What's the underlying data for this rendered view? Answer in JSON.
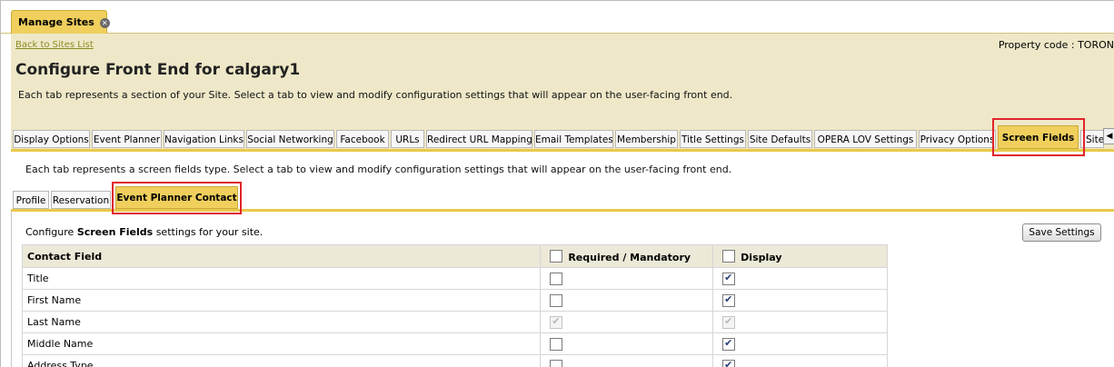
{
  "top_tab": {
    "label": "Manage Sites",
    "close_glyph": "✕"
  },
  "header": {
    "back_link": "Back to Sites List",
    "property_code": "Property code : TORON",
    "title": "Configure Front End for calgary1",
    "description": "Each tab represents a section of your Site. Select a tab to view and modify configuration settings that will appear on the user-facing front end."
  },
  "tabs": [
    {
      "label": "Display Options"
    },
    {
      "label": "Event Planner"
    },
    {
      "label": "Navigation Links"
    },
    {
      "label": "Social Networking"
    },
    {
      "label": "Facebook"
    },
    {
      "label": "URLs"
    },
    {
      "label": "Redirect URL Mapping"
    },
    {
      "label": "Email Templates"
    },
    {
      "label": "Membership"
    },
    {
      "label": "Title Settings"
    },
    {
      "label": "Site Defaults"
    },
    {
      "label": "OPERA LOV Settings"
    },
    {
      "label": "Privacy Options"
    },
    {
      "label": "Screen Fields",
      "active": true
    },
    {
      "label": "Site"
    }
  ],
  "scroll_left_glyph": "◀",
  "screen_fields": {
    "description": "Each tab represents a screen fields type. Select a tab to view and modify configuration settings that will appear on the user-facing front end.",
    "subtabs": [
      {
        "label": "Profile"
      },
      {
        "label": "Reservation"
      },
      {
        "label": "Event Planner Contact",
        "active": true
      }
    ],
    "config_prefix": "Configure ",
    "config_bold": "Screen Fields",
    "config_suffix": " settings for your site.",
    "save_label": "Save Settings"
  },
  "table": {
    "headers": {
      "field": "Contact Field",
      "required": "Required / Mandatory",
      "display": "Display"
    },
    "rows": [
      {
        "field": "Title",
        "required": false,
        "display": true,
        "disabled": false
      },
      {
        "field": "First Name",
        "required": false,
        "display": true,
        "disabled": false
      },
      {
        "field": "Last Name",
        "required": true,
        "display": true,
        "disabled": true
      },
      {
        "field": "Middle Name",
        "required": false,
        "display": true,
        "disabled": false
      },
      {
        "field": "Address Type",
        "required": false,
        "display": true,
        "disabled": false
      }
    ]
  },
  "colors": {
    "accent": "#f0cf5c",
    "band": "#eee8c8",
    "highlight": "#e0242a",
    "link": "#8b8b20"
  }
}
